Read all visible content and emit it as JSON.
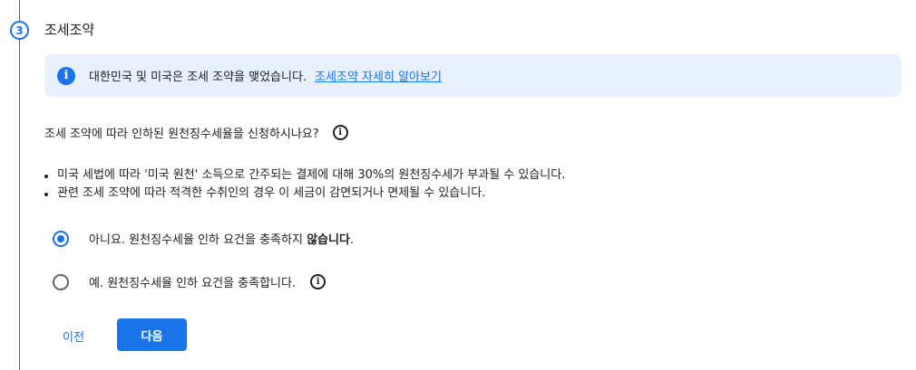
{
  "step": {
    "number": "3",
    "title": "조세조약"
  },
  "banner": {
    "icon": "info-icon",
    "text": "대한민국 및 미국은 조세 조약을 맺었습니다.",
    "link": "조세조약 자세히 알아보기"
  },
  "question": {
    "text": "조세 조약에 따라 인하된 원천징수세율을 신청하시나요?",
    "icon": "help-icon"
  },
  "bullets": [
    "미국 세법에 따라 '미국 원천' 소득으로 간주되는 결제에 대해 30%의 원천징수세가 부과될 수 있습니다.",
    "관련 조세 조약에 따라 적격한 수취인의 경우 이 세금이 감면되거나 면제될 수 있습니다."
  ],
  "options": {
    "no": {
      "prefix": "아니요. 원천징수세율 인하 요건을 충족하지 ",
      "strong": "않습니다",
      "suffix": ".",
      "selected": true
    },
    "yes": {
      "text": "예. 원천징수세율 인하 요건을 충족합니다.",
      "selected": false
    }
  },
  "buttons": {
    "prev": "이전",
    "next": "다음"
  },
  "colors": {
    "accent": "#1a73e8",
    "banner_bg": "#e8f0fe",
    "text": "#202124"
  }
}
